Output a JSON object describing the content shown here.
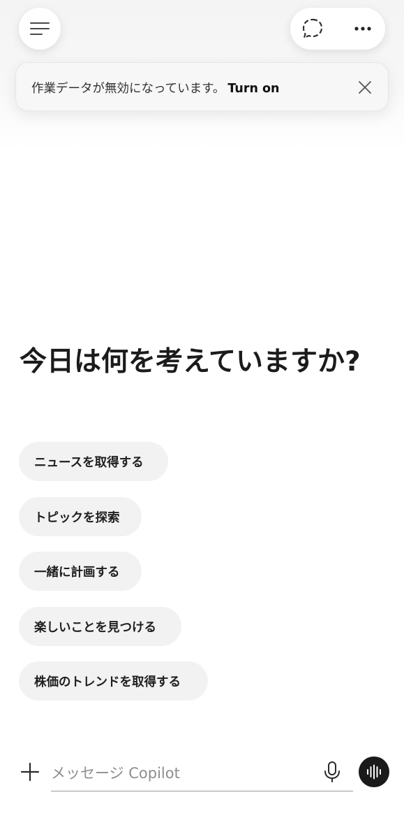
{
  "header": {
    "menu_icon": "hamburger-menu-icon",
    "new_chat_icon": "chat-bubble-icon",
    "more_icon": "more-dots-icon"
  },
  "banner": {
    "message": "作業データが無効になっています。",
    "action_label": "Turn on",
    "close_icon": "close-icon"
  },
  "main": {
    "headline": "今日は何を考えていますか?",
    "suggestions": [
      {
        "label": "ニュースを取得する"
      },
      {
        "label": "トピックを探索"
      },
      {
        "label": "一緒に計画する"
      },
      {
        "label": "楽しいことを見つける"
      },
      {
        "label": "株価のトレンドを取得する"
      }
    ]
  },
  "composer": {
    "placeholder": "メッセージ Copilot",
    "plus_icon": "plus-icon",
    "mic_icon": "microphone-icon",
    "voice_icon": "voice-waveform-icon"
  },
  "colors": {
    "background": "#ffffff",
    "chip_background": "#f2f2f2",
    "voice_button": "#1a1a1a",
    "text": "#1f1f1f"
  }
}
